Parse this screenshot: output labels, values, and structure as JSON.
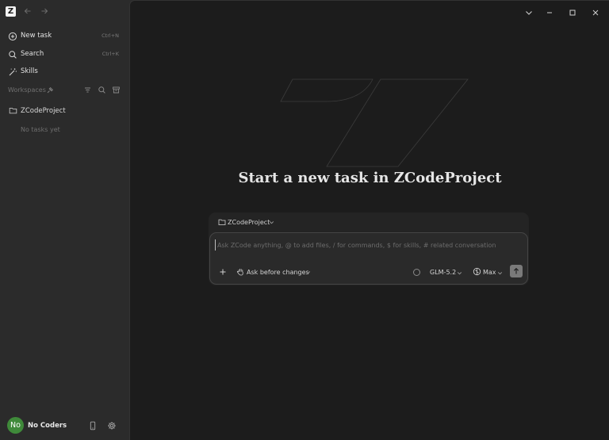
{
  "app": {
    "logo_letter": "Z"
  },
  "sidebar": {
    "menu": [
      {
        "label": "New task",
        "shortcut": "Ctrl+N",
        "icon": "plus-circle-icon"
      },
      {
        "label": "Search",
        "shortcut": "Ctrl+K",
        "icon": "search-icon"
      },
      {
        "label": "Skills",
        "shortcut": "",
        "icon": "magic-wand-icon"
      }
    ],
    "workspaces_label": "Workspaces",
    "project": {
      "name": "ZCodeProject",
      "empty_text": "No tasks yet"
    },
    "user": {
      "initials": "No",
      "name": "No Coders"
    }
  },
  "main": {
    "title": "Start a new task in ZCodeProject",
    "composer": {
      "project": "ZCodeProject",
      "placeholder": "Ask ZCode anything, @ to add files, / for commands, $ for skills, # related conversation",
      "mode": "Ask before changes",
      "model": "GLM-5.2",
      "effort": "Max"
    }
  },
  "colors": {
    "sidebar_bg": "#2b2b2b",
    "main_bg": "#1c1c1c",
    "avatar_bg": "#3f8a3a",
    "send_button": "#7a7a7a"
  }
}
